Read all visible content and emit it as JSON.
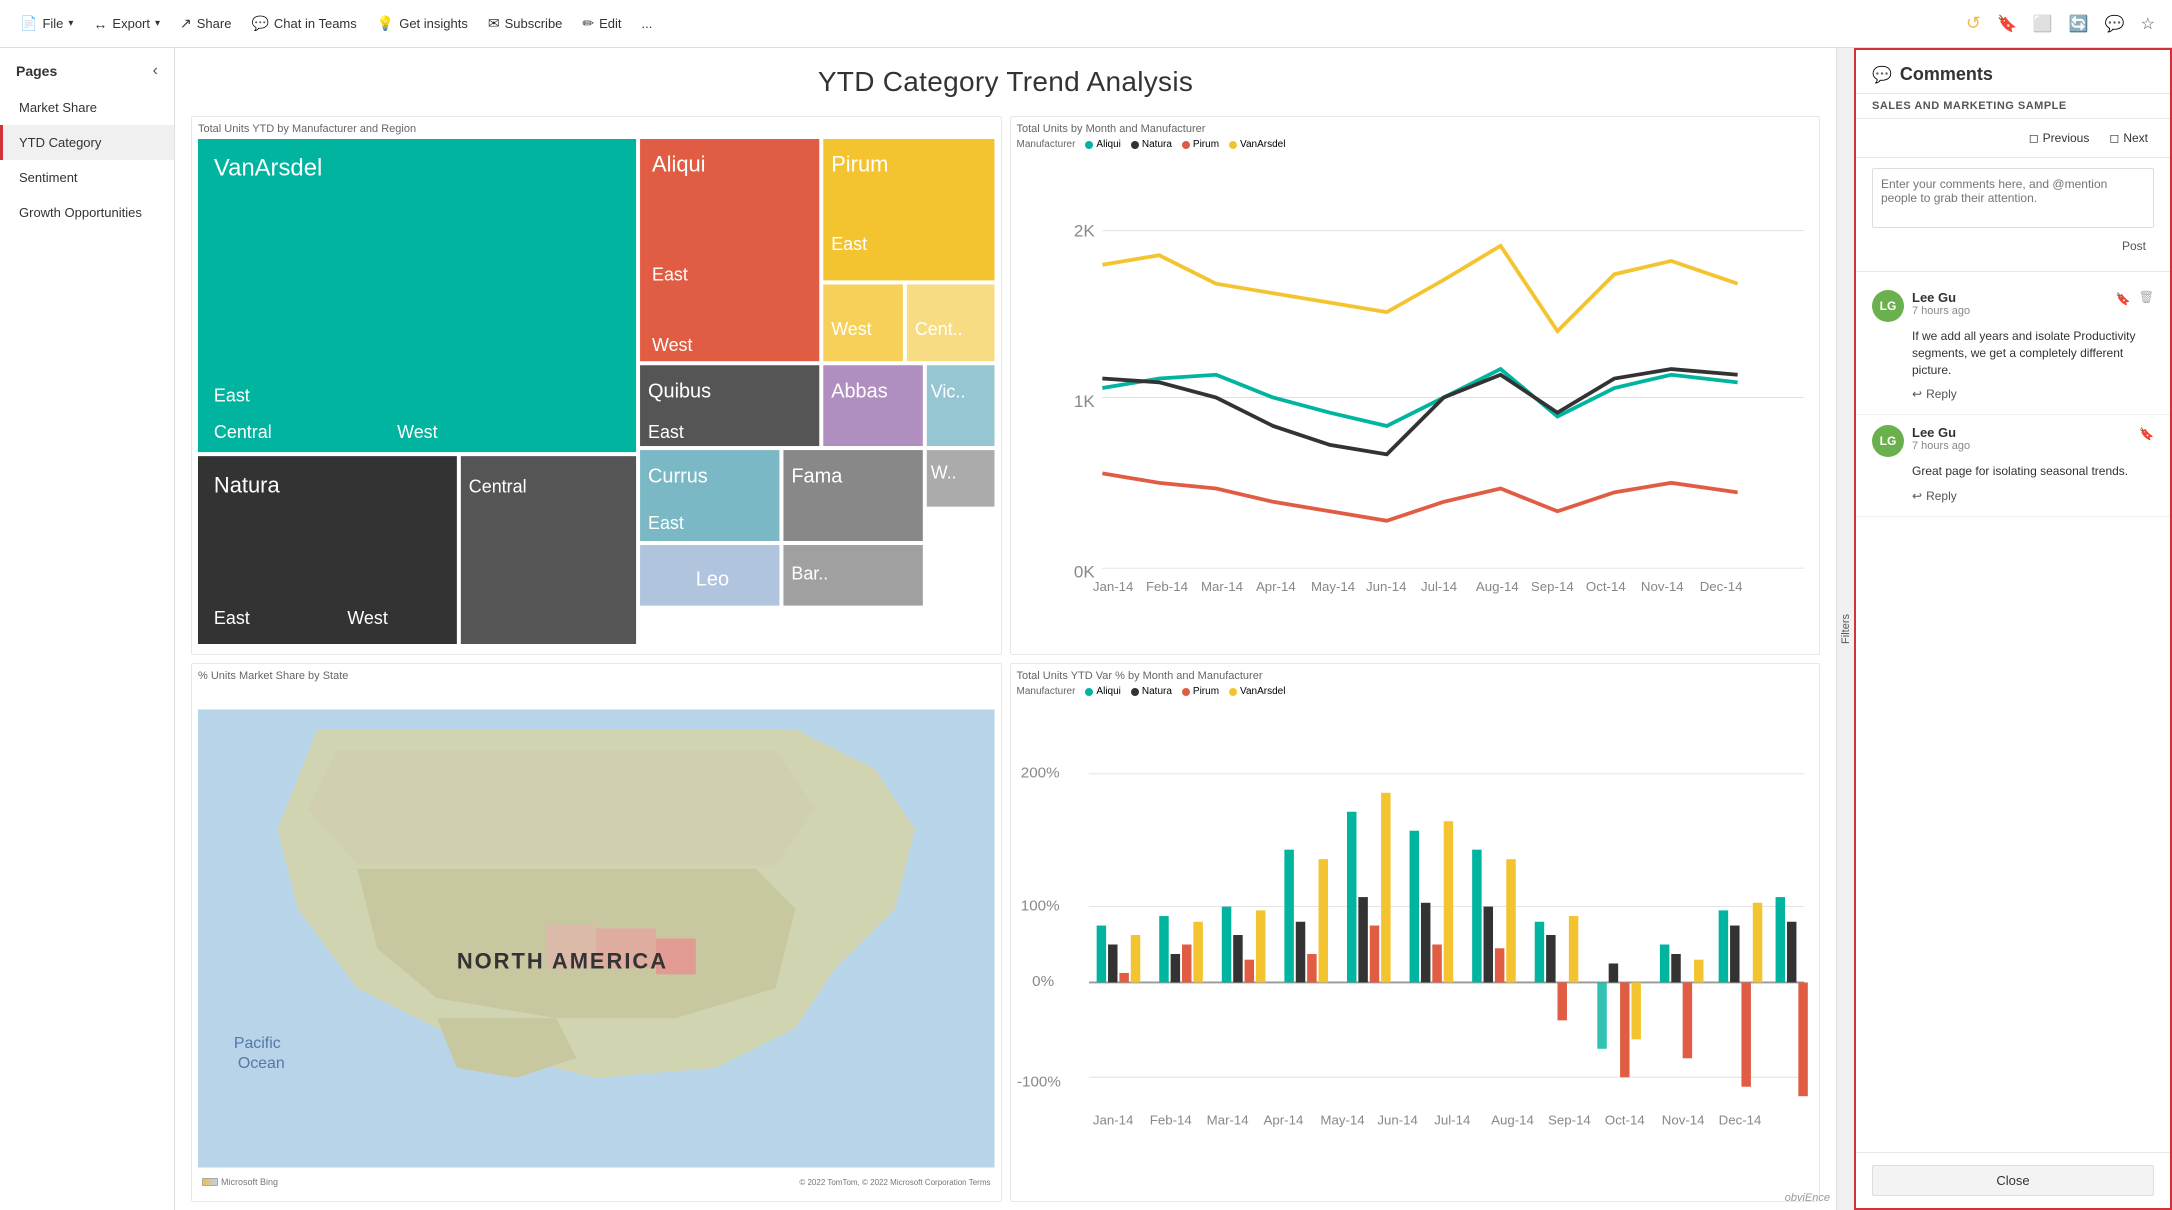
{
  "app": {
    "title": "Pages"
  },
  "toolbar": {
    "file_label": "File",
    "export_label": "Export",
    "share_label": "Share",
    "chat_label": "Chat in Teams",
    "insights_label": "Get insights",
    "subscribe_label": "Subscribe",
    "edit_label": "Edit",
    "more_label": "..."
  },
  "sidebar": {
    "header": "Pages",
    "items": [
      {
        "id": "market-share",
        "label": "Market Share",
        "active": false
      },
      {
        "id": "ytd-category",
        "label": "YTD Category",
        "active": true
      },
      {
        "id": "sentiment",
        "label": "Sentiment",
        "active": false
      },
      {
        "id": "growth",
        "label": "Growth Opportunities",
        "active": false
      }
    ]
  },
  "page": {
    "title": "YTD Category Trend Analysis"
  },
  "filters": {
    "label": "Filters"
  },
  "charts": {
    "treemap_title": "Total Units YTD by Manufacturer and Region",
    "line_title": "Total Units by Month and Manufacturer",
    "map_title": "% Units Market Share by State",
    "bar_title": "Total Units YTD Var % by Month and Manufacturer",
    "legend_label": "Manufacturer",
    "legend_items": [
      {
        "name": "Aliqui",
        "color": "#00b4a0"
      },
      {
        "name": "Natura",
        "color": "#333"
      },
      {
        "name": "Pirum",
        "color": "#e05d44"
      },
      {
        "name": "VanArsdel",
        "color": "#f4c430"
      }
    ],
    "y_axis_2k": "2K",
    "y_axis_1k": "1K",
    "y_axis_0k": "0K",
    "x_labels": [
      "Jan-14",
      "Feb-14",
      "Mar-14",
      "Apr-14",
      "May-14",
      "Jun-14",
      "Jul-14",
      "Aug-14",
      "Sep-14",
      "Oct-14",
      "Nov-14",
      "Dec-14"
    ],
    "bar_y_200": "200%",
    "bar_y_100": "100%",
    "bar_y_0": "0%",
    "bar_y_neg100": "-100%",
    "map_label": "NORTH AMERICA",
    "map_sublabel": "Pacific Ocean",
    "map_footer": "Microsoft Bing",
    "map_footer2": "© 2022 TomTom, © 2022 Microsoft Corporation  Terms"
  },
  "comments": {
    "title": "Comments",
    "subtitle": "SALES AND MARKETING SAMPLE",
    "previous_label": "Previous",
    "next_label": "Next",
    "input_placeholder": "Enter your comments here, and @mention people to grab their attention.",
    "post_label": "Post",
    "items": [
      {
        "author": "Lee Gu",
        "avatar_initials": "LG",
        "avatar_color": "#6ab04c",
        "time": "7 hours ago",
        "body": "If we add all years and isolate Productivity segments, we get a completely different picture.",
        "reply_label": "Reply"
      },
      {
        "author": "Lee Gu",
        "avatar_initials": "LG",
        "avatar_color": "#6ab04c",
        "time": "7 hours ago",
        "body": "Great page for isolating seasonal trends.",
        "reply_label": "Reply"
      }
    ],
    "close_label": "Close"
  },
  "watermark": "obviEnce"
}
